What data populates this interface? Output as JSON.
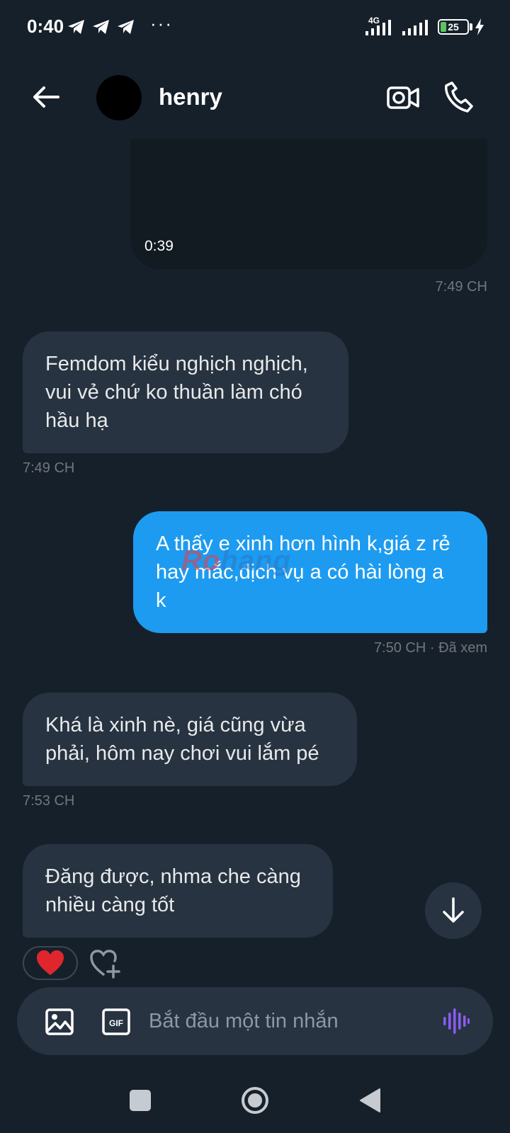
{
  "status_bar": {
    "time": "0:40",
    "network": "4G",
    "battery": "25",
    "overflow": "···",
    "icons": [
      "telegram-icon",
      "telegram-icon",
      "telegram-icon",
      "signal-icon",
      "signal-icon",
      "battery-icon",
      "charging-icon"
    ]
  },
  "header": {
    "contact_name": "henry",
    "icons": [
      "back-arrow-icon",
      "video-call-icon",
      "phone-icon"
    ]
  },
  "messages": [
    {
      "type": "video",
      "direction": "outgoing",
      "duration": "0:39",
      "time": "7:49 CH"
    },
    {
      "direction": "incoming",
      "lines": [
        "Femdom kiểu nghịch nghịch,",
        "vui vẻ chứ ko thuần làm chó",
        "hầu hạ"
      ],
      "time": "7:49 CH"
    },
    {
      "direction": "outgoing",
      "lines": [
        "A thấy e xinh hơn hình k,giá z rẻ",
        "hay mắc,dịch vụ a có hài lòng a",
        "k"
      ],
      "time": "7:50 CH · Đã xem"
    },
    {
      "direction": "incoming",
      "lines": [
        "Khá là xinh nè, giá cũng vừa",
        "phải, hôm nay chơi vui lắm pé"
      ],
      "time": "7:53 CH"
    },
    {
      "direction": "incoming",
      "lines": [
        "Đăng được, nhma che càng",
        "nhiều càng tốt"
      ],
      "reaction": "❤️"
    }
  ],
  "watermark": {
    "part_a": "Ro",
    "part_b": "hang"
  },
  "composer": {
    "placeholder": "Bắt đầu một tin nhắn",
    "icons": [
      "image-icon",
      "gif-icon",
      "voice-message-icon"
    ]
  },
  "colors": {
    "background": "#16202b",
    "incoming_bubble": "#273340",
    "outgoing_bubble": "#1d9bf0",
    "timestamp": "#71767b"
  }
}
